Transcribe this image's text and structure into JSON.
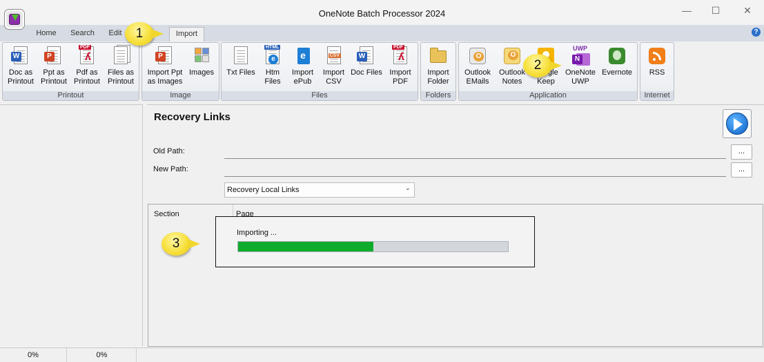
{
  "window": {
    "title": "OneNote Batch Processor 2024",
    "minimize": "—",
    "maximize": "☐",
    "close": "✕"
  },
  "tabs": [
    "Home",
    "Search",
    "Edit",
    "Import"
  ],
  "active_tab": "Import",
  "help_glyph": "?",
  "ribbon": {
    "groups": [
      {
        "label": "Printout",
        "buttons": [
          "Doc as\nPrintout",
          "Ppt as\nPrintout",
          "Pdf as\nPrintout",
          "Files as\nPrintout"
        ]
      },
      {
        "label": "Image",
        "buttons": [
          "Import Ppt\nas Images",
          "Images"
        ]
      },
      {
        "label": "Files",
        "buttons": [
          "Txt Files",
          "Htm\nFiles",
          "Import\nePub",
          "Import\nCSV",
          "Doc Files",
          "Import\nPDF"
        ]
      },
      {
        "label": "Folders",
        "buttons": [
          "Import\nFolder"
        ]
      },
      {
        "label": "Application",
        "buttons": [
          "Outlook\nEMails",
          "Outlook\nNotes",
          "Google\nKeep",
          "OneNote\nUWP",
          "Evernote"
        ]
      },
      {
        "label": "Internet",
        "buttons": [
          "RSS"
        ]
      }
    ],
    "icon_tags": {
      "html": "HTML",
      "csv": "CSV",
      "pdf": "PDF",
      "uwp": "UWP"
    }
  },
  "main": {
    "title": "Recovery Links",
    "old_path_label": "Old Path:",
    "new_path_label": "New Path:",
    "old_path_value": "",
    "new_path_value": "",
    "browse_label": "...",
    "mode_select": "Recovery Local Links",
    "grid_columns": [
      "Section",
      "Page"
    ]
  },
  "progress": {
    "text": "Importing ...",
    "fraction": 0.5,
    "color": "#0fab2d"
  },
  "callouts": [
    "1",
    "2",
    "3"
  ],
  "status": [
    "0%",
    "0%"
  ]
}
